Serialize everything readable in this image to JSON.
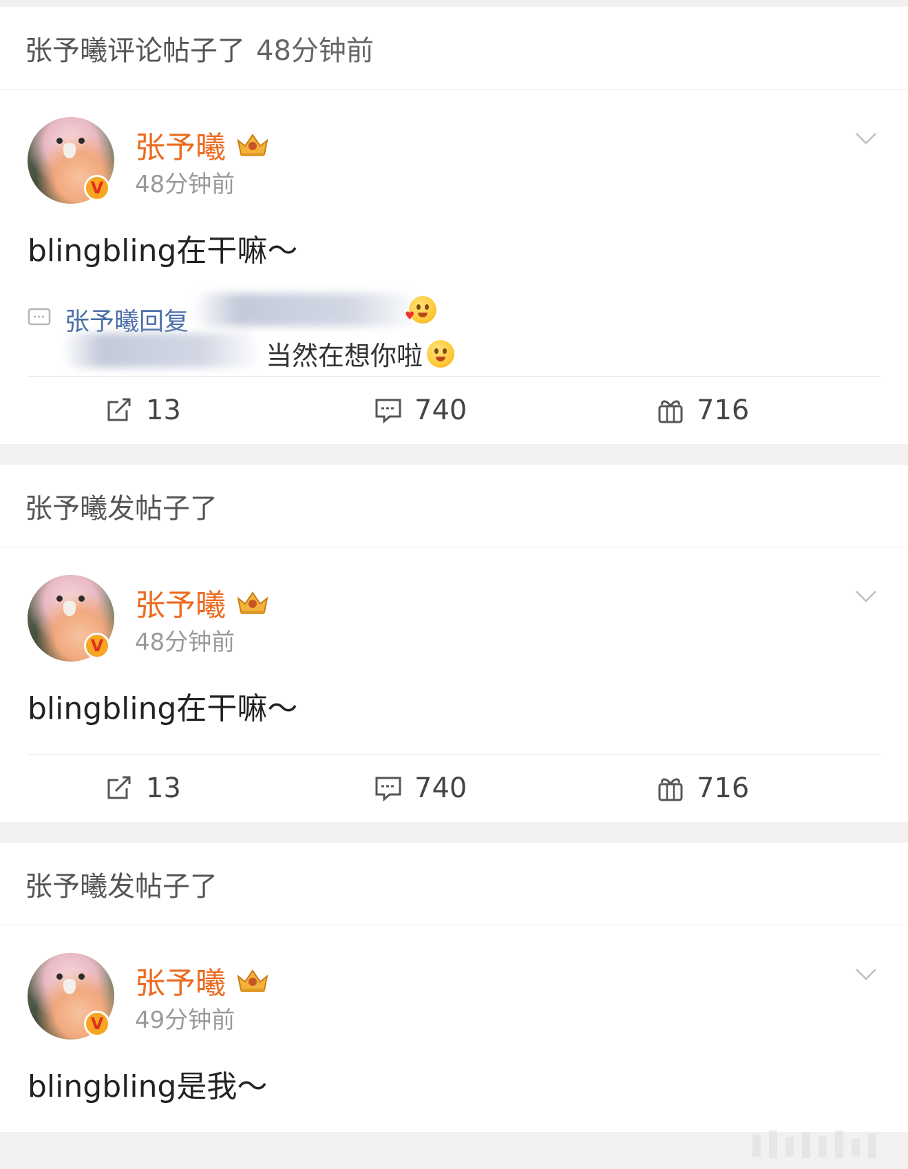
{
  "feed": [
    {
      "header": {
        "text": "张予曦评论帖子了",
        "time": "48分钟前"
      },
      "post": {
        "username": "张予曦",
        "time": "48分钟前",
        "body": "blingbling在干嘛～",
        "reply": {
          "prefix": "张予曦回复",
          "text": "当然在想你啦"
        },
        "actions": {
          "repost": "13",
          "comment": "740",
          "like": "716"
        }
      }
    },
    {
      "header": {
        "text": "张予曦发帖子了"
      },
      "post": {
        "username": "张予曦",
        "time": "48分钟前",
        "body": "blingbling在干嘛～",
        "actions": {
          "repost": "13",
          "comment": "740",
          "like": "716"
        }
      }
    },
    {
      "header": {
        "text": "张予曦发帖子了"
      },
      "post": {
        "username": "张予曦",
        "time": "49分钟前",
        "body": "blingbling是我～"
      }
    }
  ],
  "icons": {
    "verified_badge": "verified-v-badge",
    "membership": "crown-icon",
    "menu": "chevron-down-icon",
    "repost": "repost-icon",
    "comment": "comment-icon",
    "like": "like-gift-icon"
  },
  "colors": {
    "username": "#ec6b1f",
    "reply_name": "#4a6ea8",
    "meta": "#999999"
  }
}
